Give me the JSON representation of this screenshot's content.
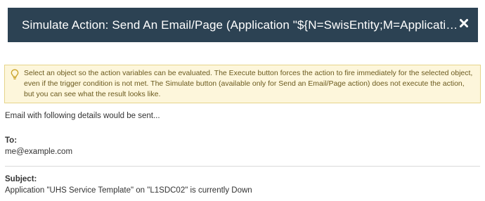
{
  "dialog": {
    "title": "Simulate Action: Send An Email/Page (Application \"${N=SwisEntity;M=ApplicationAl...",
    "close_icon": "close-icon"
  },
  "hint": {
    "icon": "lightbulb-icon",
    "text": "Select an object so the action variables can be evaluated. The Execute button forces the action to fire immediately for the selected object, even if the trigger condition is not met. The Simulate button (available only for Send an Email/Page action) does not execute the action, but you can see what the result looks like."
  },
  "intro_text": "Email with following details would be sent...",
  "fields": {
    "to": {
      "label": "To:",
      "value": "me@example.com"
    },
    "subject": {
      "label": "Subject:",
      "value": "Application \"UHS Service Template\" on \"L1SDC02\" is currently Down"
    }
  },
  "colors": {
    "title_bar": "#2c4253",
    "hint_background": "#fdf6db",
    "hint_border": "#e6d48a"
  }
}
